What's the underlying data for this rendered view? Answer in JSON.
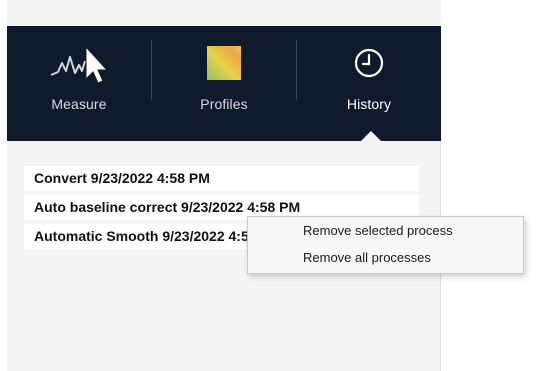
{
  "nav": {
    "tabs": [
      {
        "label": "Measure",
        "icon": "measure-cursor-icon",
        "active": false
      },
      {
        "label": "Profiles",
        "icon": "profiles-gradient-icon",
        "active": false
      },
      {
        "label": "History",
        "icon": "clock-icon",
        "active": true
      }
    ],
    "background": "#0f1b2d"
  },
  "history": {
    "items": [
      "Convert 9/23/2022 4:58 PM",
      "Auto baseline correct 9/23/2022 4:58 PM",
      "Automatic Smooth 9/23/2022 4:58 PM"
    ]
  },
  "context_menu": {
    "items": [
      "Remove selected process",
      "Remove all processes"
    ]
  }
}
